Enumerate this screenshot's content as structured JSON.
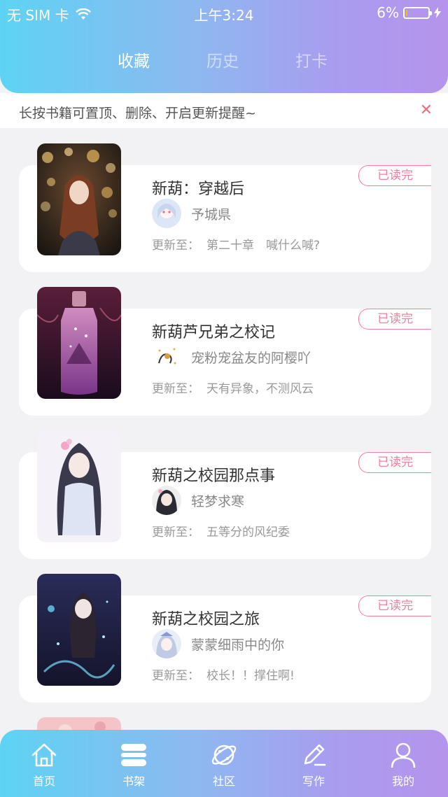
{
  "status": {
    "carrier": "无 SIM 卡",
    "time": "上午3:24",
    "battery": "6%",
    "battery_level": 0.06
  },
  "tabs": [
    {
      "label": "收藏",
      "active": true
    },
    {
      "label": "历史",
      "active": false
    },
    {
      "label": "打卡",
      "active": false
    }
  ],
  "tip": {
    "text": "长按书籍可置顶、删除、开启更新提醒~",
    "close_icon": "✕"
  },
  "books": [
    {
      "title": "新葫：穿越后",
      "author": "予城県",
      "update_label": "更新至：",
      "update_text": "第二十章　喊什么喊?",
      "badge": "已读完"
    },
    {
      "title": "新葫芦兄弟之校记",
      "author": "宠粉宠盆友的阿樱吖",
      "update_label": "更新至：",
      "update_text": "天有异象，不测风云",
      "badge": "已读完"
    },
    {
      "title": "新葫之校园那点事",
      "author": "轻梦求寒",
      "update_label": "更新至：",
      "update_text": "五等分的风纪委",
      "badge": "已读完"
    },
    {
      "title": "新葫之校园之旅",
      "author": "蒙蒙细雨中的你",
      "update_label": "更新至：",
      "update_text": "校长！！撑住啊!",
      "badge": "已读完"
    }
  ],
  "nav": [
    {
      "label": "首页",
      "icon": "home-icon"
    },
    {
      "label": "书架",
      "icon": "bookshelf-icon"
    },
    {
      "label": "社区",
      "icon": "planet-icon"
    },
    {
      "label": "写作",
      "icon": "pen-icon"
    },
    {
      "label": "我的",
      "icon": "user-icon"
    }
  ],
  "colors": {
    "gradient_start": "#5ed3f3",
    "gradient_end": "#b594ec",
    "badge": "#f27f9c",
    "close": "#f06b7e",
    "battery_fill": "#f5c400"
  }
}
